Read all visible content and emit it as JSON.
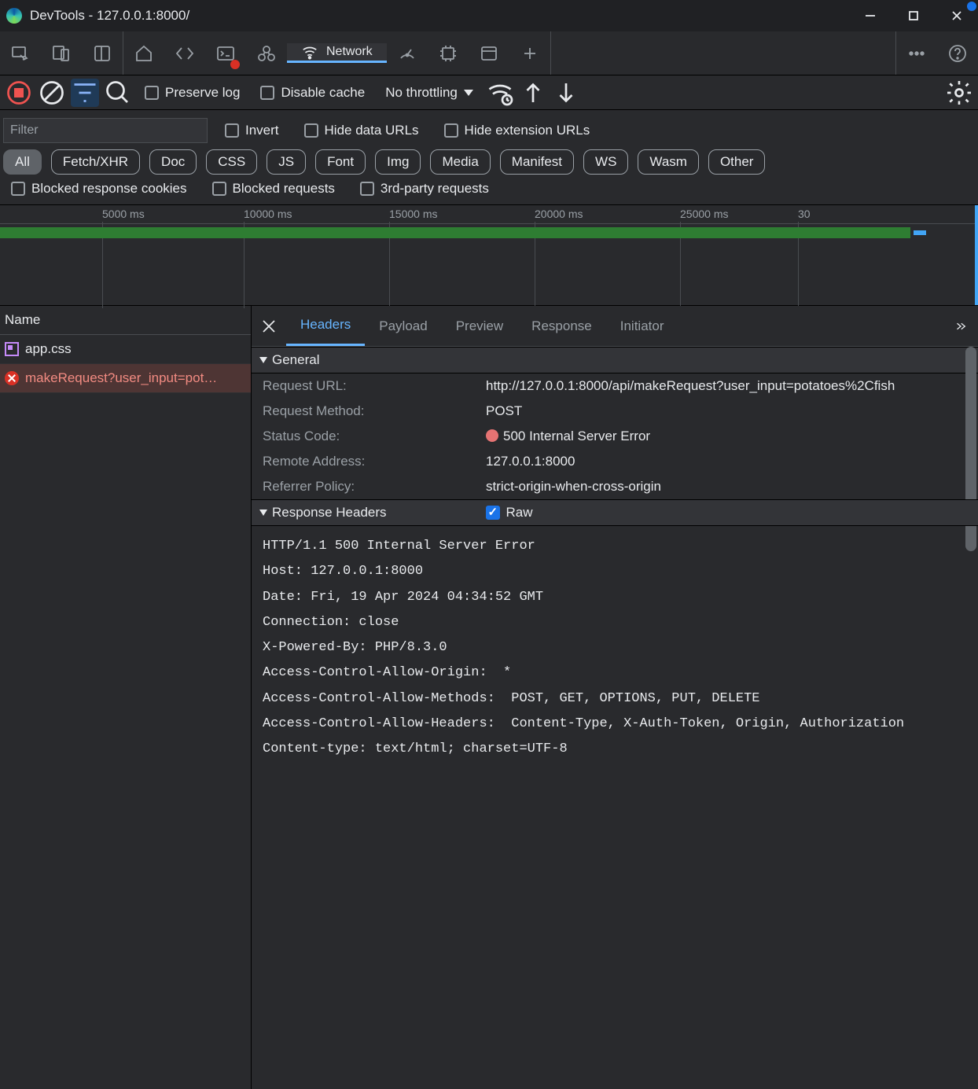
{
  "window": {
    "title": "DevTools - 127.0.0.1:8000/"
  },
  "mainTabs": {
    "network": "Network"
  },
  "netBar": {
    "preserveLog": "Preserve log",
    "disableCache": "Disable cache",
    "throttling": "No throttling"
  },
  "filters": {
    "placeholder": "Filter",
    "invert": "Invert",
    "hideData": "Hide data URLs",
    "hideExt": "Hide extension URLs",
    "types": [
      "All",
      "Fetch/XHR",
      "Doc",
      "CSS",
      "JS",
      "Font",
      "Img",
      "Media",
      "Manifest",
      "WS",
      "Wasm",
      "Other"
    ],
    "blockedCookies": "Blocked response cookies",
    "blockedReq": "Blocked requests",
    "thirdParty": "3rd-party requests"
  },
  "timeline": {
    "ticks": [
      "5000 ms",
      "10000 ms",
      "15000 ms",
      "20000 ms",
      "25000 ms",
      "30"
    ]
  },
  "list": {
    "header": "Name",
    "rows": [
      {
        "name": "app.css",
        "kind": "css"
      },
      {
        "name": "makeRequest?user_input=pot…",
        "kind": "error"
      }
    ]
  },
  "detail": {
    "tabs": [
      "Headers",
      "Payload",
      "Preview",
      "Response",
      "Initiator"
    ],
    "general": {
      "title": "General",
      "requestUrlK": "Request URL:",
      "requestUrlV": "http://127.0.0.1:8000/api/makeRequest?user_input=potatoes%2Cfish",
      "methodK": "Request Method:",
      "methodV": "POST",
      "statusK": "Status Code:",
      "statusV": "500 Internal Server Error",
      "remoteK": "Remote Address:",
      "remoteV": "127.0.0.1:8000",
      "referrerK": "Referrer Policy:",
      "referrerV": "strict-origin-when-cross-origin"
    },
    "responseHeaders": {
      "title": "Response Headers",
      "rawLabel": "Raw",
      "raw": "HTTP/1.1 500 Internal Server Error\nHost: 127.0.0.1:8000\nDate: Fri, 19 Apr 2024 04:34:52 GMT\nConnection: close\nX-Powered-By: PHP/8.3.0\nAccess-Control-Allow-Origin:  *\nAccess-Control-Allow-Methods:  POST, GET, OPTIONS, PUT, DELETE\nAccess-Control-Allow-Headers:  Content-Type, X-Auth-Token, Origin, Authorization\nContent-type: text/html; charset=UTF-8"
    }
  }
}
